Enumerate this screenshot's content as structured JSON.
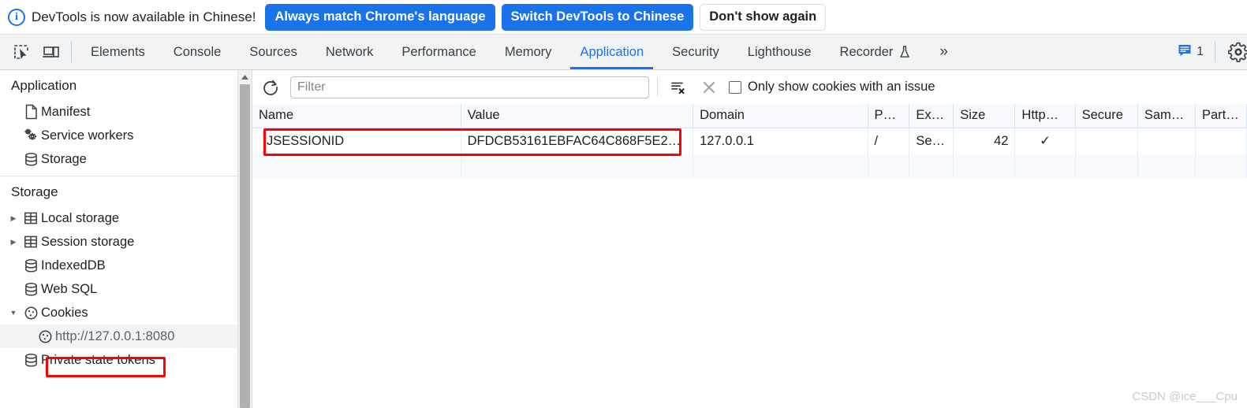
{
  "banner": {
    "icon": "info-circle-icon",
    "message": "DevTools is now available in Chinese!",
    "buttons": [
      {
        "label": "Always match Chrome's language",
        "style": "primary"
      },
      {
        "label": "Switch DevTools to Chinese",
        "style": "primary"
      },
      {
        "label": "Don't show again",
        "style": "ghost"
      }
    ]
  },
  "toolbar": {
    "inspect_icon": "inspect-element-icon",
    "device_icon": "device-toolbar-icon",
    "overflow_label": "»",
    "issues_count": "1",
    "issues_icon": "issues-message-icon",
    "settings_icon": "gear-icon",
    "tabs": [
      {
        "label": "Elements",
        "active": false
      },
      {
        "label": "Console",
        "active": false
      },
      {
        "label": "Sources",
        "active": false
      },
      {
        "label": "Network",
        "active": false
      },
      {
        "label": "Performance",
        "active": false
      },
      {
        "label": "Memory",
        "active": false
      },
      {
        "label": "Application",
        "active": true
      },
      {
        "label": "Security",
        "active": false
      },
      {
        "label": "Lighthouse",
        "active": false
      },
      {
        "label": "Recorder",
        "active": false,
        "badge_icon": "flask-icon"
      }
    ]
  },
  "sidebar": {
    "sections": [
      {
        "title": "Application",
        "items": [
          {
            "label": "Manifest",
            "icon": "document-icon",
            "twisty": "",
            "selected": false
          },
          {
            "label": "Service workers",
            "icon": "gears-icon",
            "twisty": "",
            "selected": false
          },
          {
            "label": "Storage",
            "icon": "database-icon",
            "twisty": "",
            "selected": false
          }
        ]
      },
      {
        "title": "Storage",
        "items": [
          {
            "label": "Local storage",
            "icon": "table-icon",
            "twisty": "collapsed",
            "selected": false
          },
          {
            "label": "Session storage",
            "icon": "table-icon",
            "twisty": "collapsed",
            "selected": false
          },
          {
            "label": "IndexedDB",
            "icon": "database-icon",
            "twisty": "",
            "selected": false
          },
          {
            "label": "Web SQL",
            "icon": "database-icon",
            "twisty": "",
            "selected": false
          },
          {
            "label": "Cookies",
            "icon": "cookie-icon",
            "twisty": "expanded",
            "selected": false
          },
          {
            "label": "http://127.0.0.1:8080",
            "icon": "cookie-icon",
            "twisty": "",
            "selected": true,
            "child": true,
            "annotated": true
          },
          {
            "label": "Private state tokens",
            "icon": "database-icon",
            "twisty": "",
            "selected": false
          }
        ]
      }
    ]
  },
  "cookies_panel": {
    "refresh_icon": "refresh-icon",
    "filter": {
      "value": "",
      "placeholder": "Filter"
    },
    "clear_filtered_icon": "clear-filtered-cookies-icon",
    "delete_icon": "delete-cookie-icon",
    "issue_checkbox": {
      "label": "Only show cookies with an issue",
      "checked": false
    },
    "columns": [
      "Name",
      "Value",
      "Domain",
      "Pa…",
      "Ex…",
      "Size",
      "Http…",
      "Secure",
      "Same…",
      "Partiti…"
    ],
    "rows": [
      {
        "name": "JSESSIONID",
        "value": "DFDCB53161EBFAC64C868F5E2…",
        "domain": "127.0.0.1",
        "path": "/",
        "expires": "Se…",
        "size": "42",
        "httponly": "✓",
        "secure": "",
        "samesite": "",
        "partition": "",
        "annotated": true
      }
    ],
    "watermark": "CSDN @ice___Cpu"
  },
  "colors": {
    "accent": "#1a73e8",
    "annotation": "#fe0000",
    "toolbar_bg": "#f1f3f4",
    "header_bg": "#f7f9fc"
  }
}
